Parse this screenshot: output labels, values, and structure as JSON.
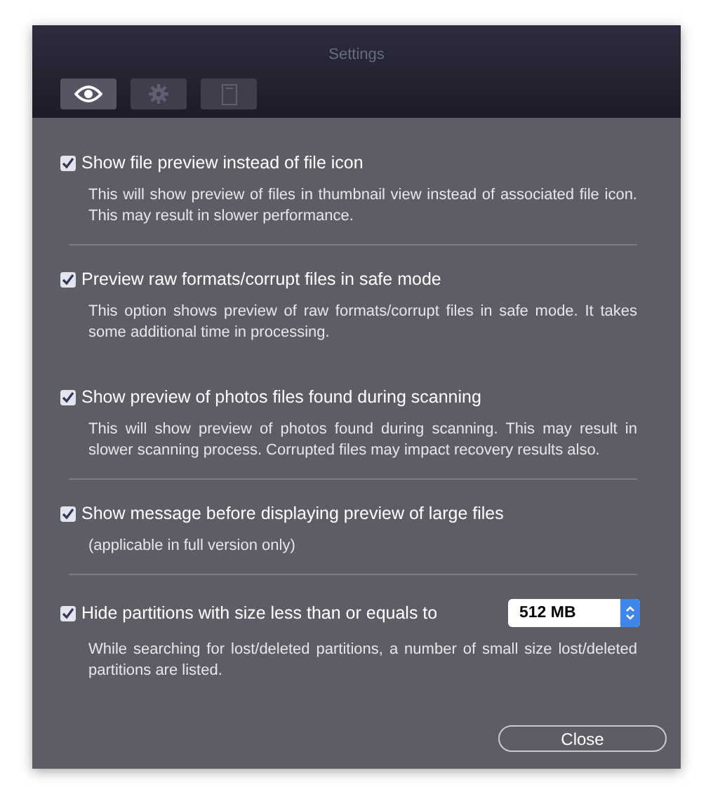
{
  "window": {
    "title": "Settings"
  },
  "tabs": [
    {
      "kind": "eye",
      "selected": true
    },
    {
      "kind": "gear",
      "selected": false
    },
    {
      "kind": "book",
      "selected": false
    }
  ],
  "options": [
    {
      "label": "Show file preview instead of file icon",
      "checked": true,
      "description": "This will show preview of files in thumbnail view instead of associated file icon. This may result in slower performance.",
      "divider": true
    },
    {
      "label": "Preview raw formats/corrupt files in safe mode",
      "checked": true,
      "description": "This option shows preview of raw formats/corrupt files in safe mode. It takes some additional time in processing.",
      "divider": false
    },
    {
      "label": "Show preview of photos files found during scanning",
      "checked": true,
      "description": "This will show preview of photos found during scanning. This may result in slower scanning process. Corrupted files may impact recovery results also.",
      "divider": true
    },
    {
      "label": "Show message before displaying preview of large files",
      "checked": true,
      "description": "(applicable in full version only)",
      "divider": true
    },
    {
      "label": "Hide partitions with size less than or equals to",
      "checked": true,
      "description": "While searching for lost/deleted partitions, a number of small size lost/deleted partitions are listed.",
      "select": "512 MB",
      "divider": false
    }
  ],
  "buttons": [
    {
      "label": "Close"
    }
  ]
}
